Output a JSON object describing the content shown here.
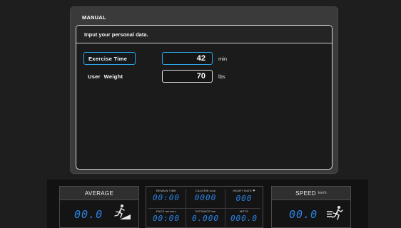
{
  "panel": {
    "title": "MANUAL",
    "header": "Input your personal data.",
    "fields": [
      {
        "label": "Exercise Time",
        "value": "42",
        "unit": "min"
      },
      {
        "label": "User  Weight",
        "value": "70",
        "unit": "lbs"
      }
    ]
  },
  "console": {
    "average": {
      "label": "AVERAGE",
      "value": "00.0",
      "icon": "runner-incline-icon"
    },
    "stats": [
      {
        "label": "REMAIN TIME",
        "value": "00:00"
      },
      {
        "label": "CALORIE kcal",
        "value": "0000"
      },
      {
        "label": "HEART RATE",
        "value": "000",
        "icon": "heart-icon"
      },
      {
        "label": "PACE min/sec",
        "value": "00:00"
      },
      {
        "label": "DISTANCE km",
        "value": "0.000"
      },
      {
        "label": "METS",
        "value": "000.0"
      }
    ],
    "speed": {
      "label": "SPEED",
      "unit": "km/h",
      "value": "00.0",
      "icon": "runner-speed-icon"
    }
  },
  "colors": {
    "accent": "#2aa8e8",
    "digits": "#2b84e6",
    "background": "#1e1e1e"
  }
}
